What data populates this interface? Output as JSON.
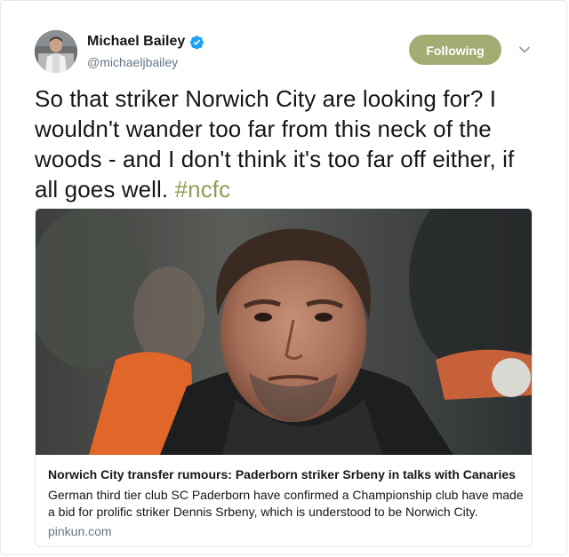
{
  "author": {
    "display_name": "Michael Bailey",
    "handle": "@michaeljbailey",
    "verified": true
  },
  "follow_button": {
    "label": "Following",
    "color": "#a2ad73"
  },
  "icons": {
    "verified": "verified-badge-icon",
    "menu": "chevron-down-icon"
  },
  "tweet": {
    "text": "So that striker Norwich City are looking for? I wouldn't wander too far from this neck of the woods - and I don't think it's too far off either, if all goes well. ",
    "hashtag": "#ncfc",
    "hashtag_color": "#8f9c55"
  },
  "card": {
    "title": "Norwich City transfer rumours: Paderborn striker Srbeny in talks with Canaries",
    "description": "German third tier club SC Paderborn have confirmed a Championship club have made a bid for prolific striker Dennis Srbeny, which is understood to be Norwich City.",
    "domain": "pinkun.com"
  }
}
